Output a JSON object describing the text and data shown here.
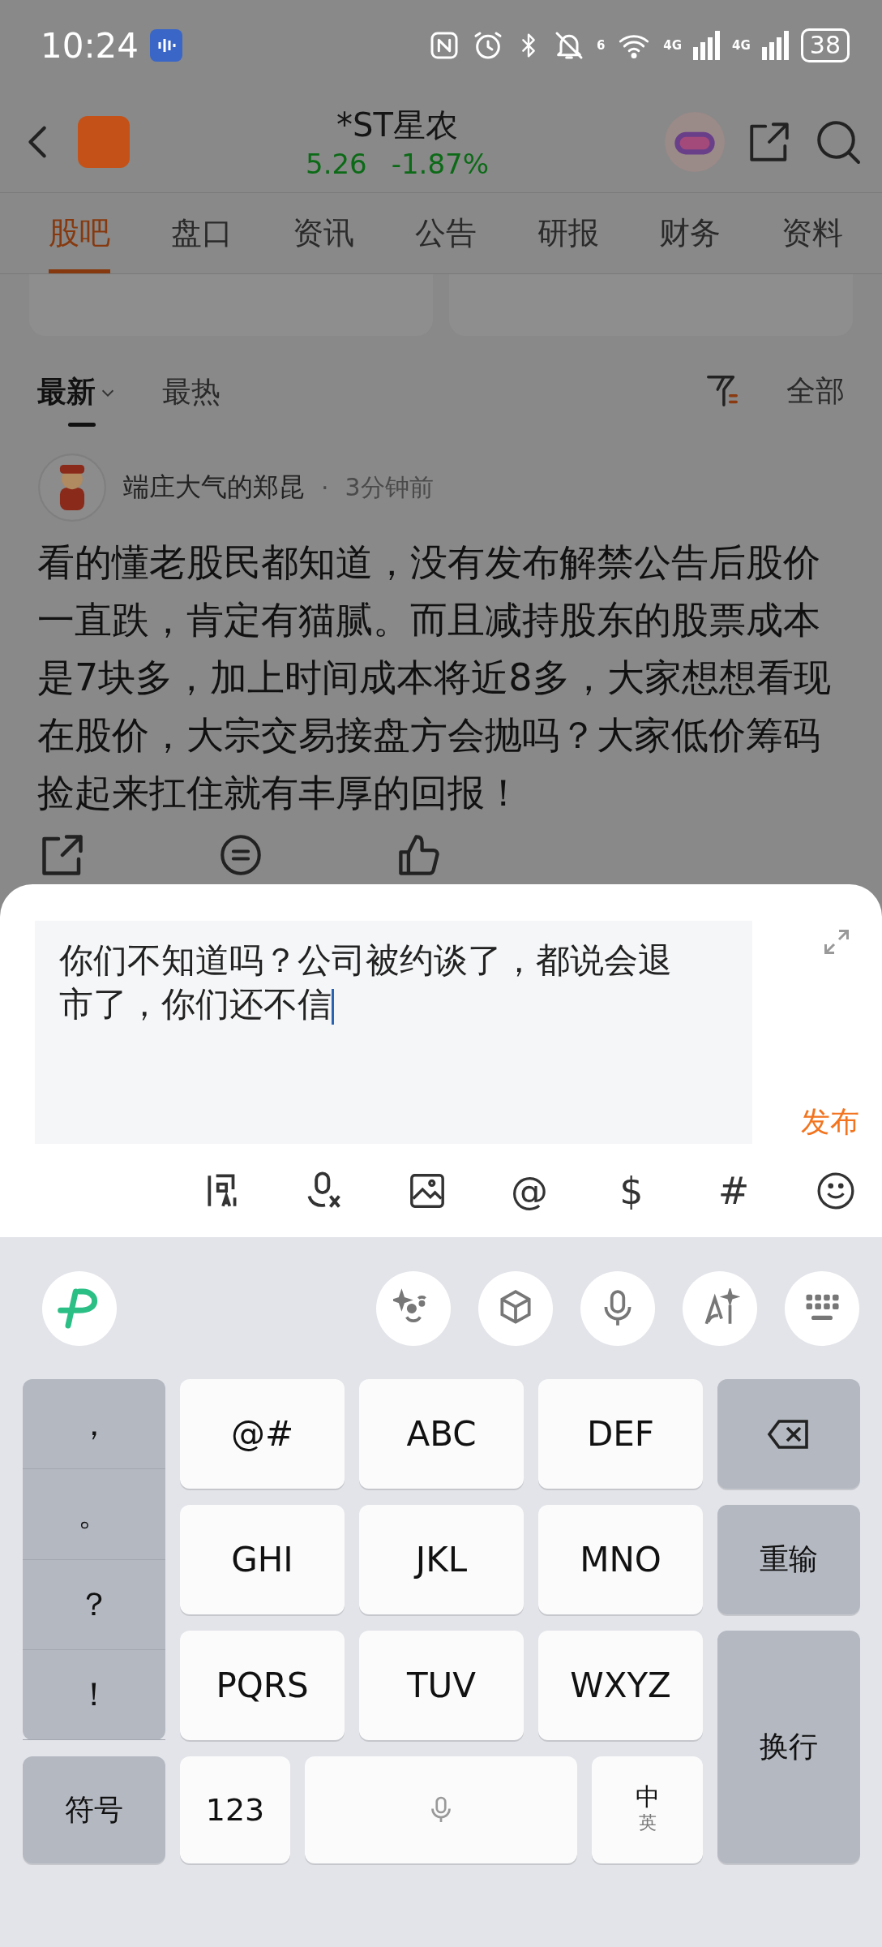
{
  "status_bar": {
    "time": "10:24",
    "network_label": "6",
    "signal_labels": [
      "4G",
      "4G"
    ],
    "battery": "38"
  },
  "header": {
    "title": "*ST星农",
    "price": "5.26",
    "change": "-1.87%"
  },
  "tabs": [
    {
      "label": "股吧",
      "selected": true
    },
    {
      "label": "盘口",
      "selected": false
    },
    {
      "label": "资讯",
      "selected": false
    },
    {
      "label": "公告",
      "selected": false
    },
    {
      "label": "研报",
      "selected": false
    },
    {
      "label": "财务",
      "selected": false
    },
    {
      "label": "资料",
      "selected": false
    }
  ],
  "sort_tabs": [
    {
      "label": "最新",
      "selected": true
    },
    {
      "label": "最热",
      "selected": false
    }
  ],
  "filter": "全部",
  "post": {
    "author": "端庄大气的郑昆",
    "separator": "·",
    "time": "3分钟前",
    "text": "看的懂老股民都知道，没有发布解禁公告后股价一直跌，肯定有猫腻。而且减持股东的股票成本是7块多，加上时间成本将近8多，大家想想看现在股价，大宗交易接盘方会抛吗？大家低价筹码捡起来扛住就有丰厚的回报！",
    "actions": [
      {
        "kind": "share"
      },
      {
        "kind": "comment"
      },
      {
        "kind": "like"
      }
    ]
  },
  "composer": {
    "value": "你们不知道吗？公司被约谈了，都说会退市了，你们还不信",
    "submit": "发布",
    "tools": [
      {
        "kind": "ai"
      },
      {
        "kind": "voice"
      },
      {
        "kind": "image"
      },
      {
        "kind": "text",
        "label": "@"
      },
      {
        "kind": "text",
        "label": "$"
      },
      {
        "kind": "text",
        "label": "#"
      },
      {
        "kind": "emoji"
      }
    ]
  },
  "keyboard": {
    "punctuation": [
      "，",
      "。",
      "？",
      "！"
    ],
    "rows": [
      [
        "@#",
        "ABC",
        "DEF"
      ],
      [
        "GHI",
        "JKL",
        "MNO"
      ],
      [
        "PQRS",
        "TUV",
        "WXYZ"
      ]
    ],
    "reenter": "重输",
    "enter": "换行",
    "symbols": "符号",
    "numbers": "123",
    "lang_main": "中",
    "lang_alt": "英"
  }
}
